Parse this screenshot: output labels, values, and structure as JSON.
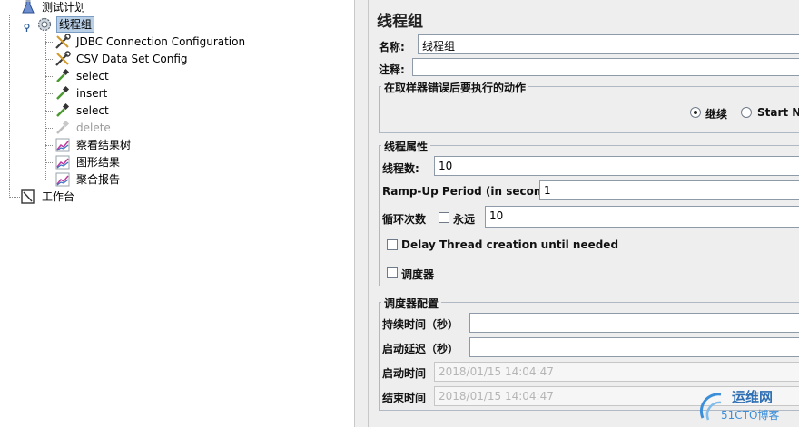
{
  "tree": {
    "root": {
      "label": "测试计划",
      "icon": "test-plan-flask-icon"
    },
    "thread_group": {
      "label": "线程组",
      "icon": "gear-icon"
    },
    "children": [
      {
        "label": "JDBC Connection Configuration",
        "icon": "wrench-icon",
        "disabled": false
      },
      {
        "label": "CSV Data Set Config",
        "icon": "wrench-icon",
        "disabled": false
      },
      {
        "label": "select",
        "icon": "pipette-sampler-icon",
        "disabled": false
      },
      {
        "label": "insert",
        "icon": "pipette-sampler-icon",
        "disabled": false
      },
      {
        "label": "select",
        "icon": "pipette-sampler-icon",
        "disabled": false
      },
      {
        "label": "delete",
        "icon": "pipette-sampler-icon",
        "disabled": true
      },
      {
        "label": "察看结果树",
        "icon": "chart-listener-icon",
        "disabled": false
      },
      {
        "label": "图形结果",
        "icon": "chart-listener-icon",
        "disabled": false
      },
      {
        "label": "聚合报告",
        "icon": "chart-listener-icon",
        "disabled": false
      }
    ],
    "workbench": {
      "label": "工作台",
      "icon": "workbench-icon"
    }
  },
  "panel": {
    "title": "线程组",
    "name_label": "名称:",
    "name_value": "线程组",
    "comment_label": "注释:",
    "comment_value": "",
    "error_action": {
      "title": "在取样器错误后要执行的动作",
      "options": [
        {
          "label": "继续",
          "checked": true
        },
        {
          "label": "Start Ne",
          "checked": false
        }
      ]
    },
    "thread_props": {
      "title": "线程属性",
      "threads_label": "线程数:",
      "threads_value": "10",
      "rampup_label": "Ramp-Up Period (in seconds):",
      "rampup_value": "1",
      "loop_label": "循环次数",
      "forever_label": "永远",
      "loop_value": "10",
      "delay_label": "Delay Thread creation until needed",
      "scheduler_label": "调度器"
    },
    "scheduler": {
      "title": "调度器配置",
      "duration_label": "持续时间（秒）",
      "duration_value": "",
      "delay_label": "启动延迟（秒）",
      "delay_value": "",
      "start_label": "启动时间",
      "start_value": "2018/01/15 14:04:47",
      "end_label": "结束时间",
      "end_value": "2018/01/15 14:04:47"
    }
  },
  "watermark": {
    "title": "运维网",
    "subtitle": "51CTO博客"
  },
  "colors": {
    "selection": "#b8cfe5",
    "accent": "#3b8fd9"
  }
}
